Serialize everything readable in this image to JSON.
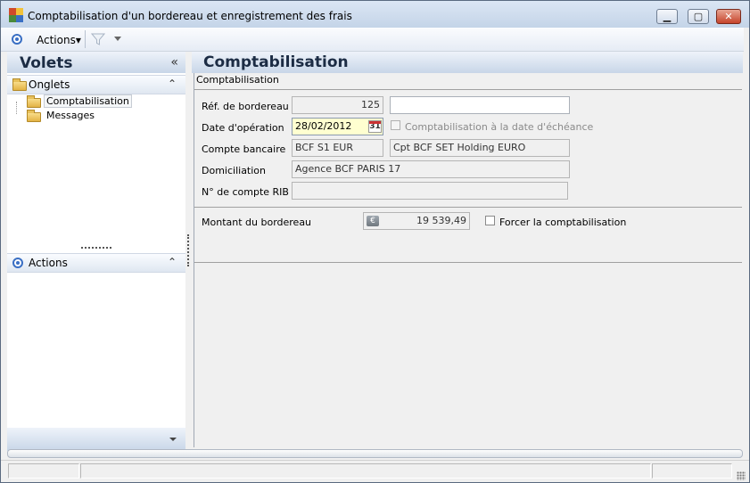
{
  "window": {
    "title": "Comptabilisation d'un bordereau et enregistrement des frais",
    "minimize_glyph": "▁",
    "maximize_glyph": "▢",
    "close_glyph": "✕"
  },
  "toolbar": {
    "actions_label": "Actions▾",
    "filter_icon": "filter-icon"
  },
  "left_panel": {
    "title": "Volets",
    "collapse_glyph": "«",
    "onglets": {
      "title": "Onglets",
      "chevron": "⌃",
      "items": [
        {
          "label": "Comptabilisation",
          "selected": true
        },
        {
          "label": "Messages",
          "selected": false
        }
      ]
    },
    "actions": {
      "title": "Actions",
      "chevron": "⌃"
    }
  },
  "main": {
    "title": "Comptabilisation",
    "group_caption": "Comptabilisation",
    "fields": {
      "ref_label": "Réf. de bordereau",
      "ref_value": "125",
      "ref_extra": "",
      "date_label": "Date d'opération",
      "date_value": "28/02/2012",
      "calendar_glyph": "31",
      "echeance_label": "Comptabilisation à la date d'échéance",
      "echeance_checked": false,
      "compte_label": "Compte bancaire",
      "compte_code": "BCF S1 EUR",
      "compte_name": "Cpt BCF SET Holding EURO",
      "domic_label": "Domiciliation",
      "domic_value": "Agence BCF PARIS 17",
      "rib_label": "N° de compte RIB",
      "rib_value": "",
      "montant_label": "Montant du bordereau",
      "euro_glyph": "€",
      "montant_value": "19 539,49",
      "forcer_label": "Forcer la comptabilisation",
      "forcer_checked": false
    }
  },
  "colors": {
    "header_gradient_top": "#eef3fa",
    "header_gradient_bottom": "#c8d6e8",
    "title_text": "#1c2c44",
    "date_field_bg": "#ffffd0",
    "accent_blue": "#3a6fc4"
  }
}
